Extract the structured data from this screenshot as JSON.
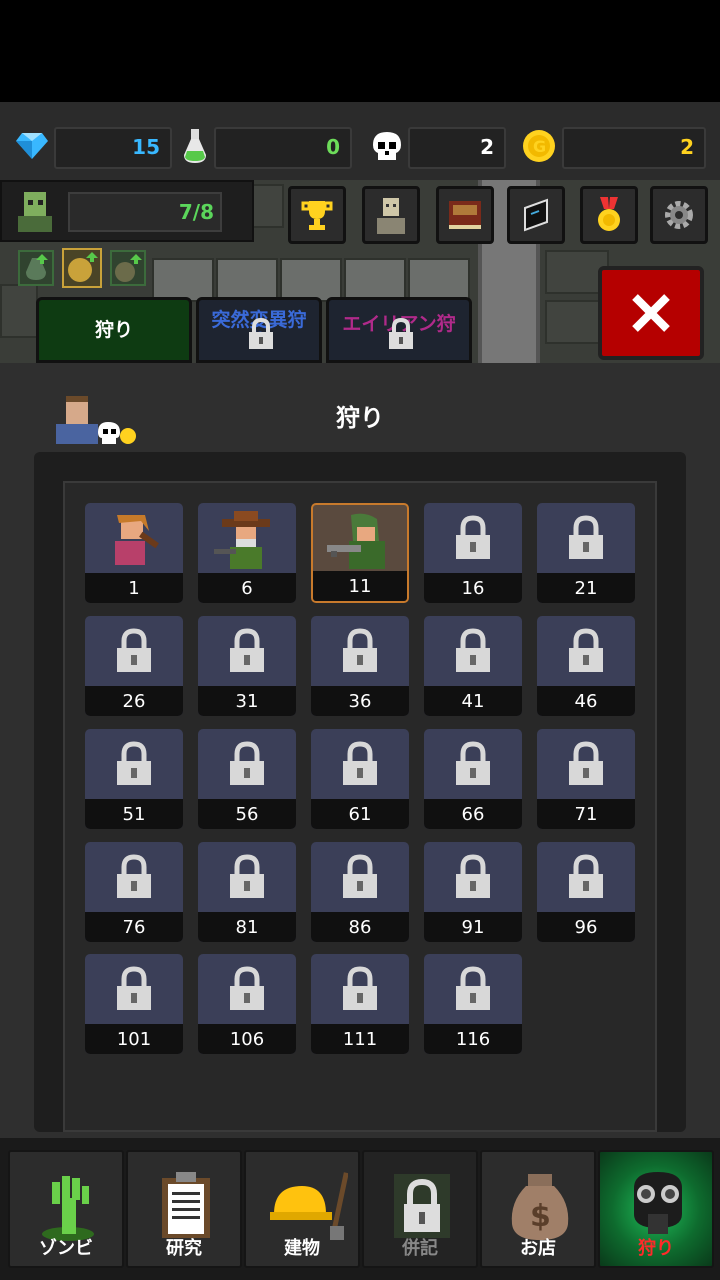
{
  "resources": [
    {
      "name": "gem-icon",
      "value": "15",
      "color": "#39b8ff"
    },
    {
      "name": "potion-icon",
      "value": "0",
      "color": "#6ddc5a"
    },
    {
      "name": "skull-icon",
      "value": "2",
      "color": "#ffffff"
    },
    {
      "name": "coin-icon",
      "value": "2",
      "color": "#ffd21f"
    }
  ],
  "zombie_count": "7/8",
  "header_buttons": [
    "trophy-icon",
    "zombie-bust-icon",
    "book-icon",
    "notebook-icon",
    "medal-icon",
    "gear-icon"
  ],
  "tabs": [
    {
      "label": "狩り",
      "locked": false
    },
    {
      "label": "突然変異狩り",
      "locked": true
    },
    {
      "label": "エイリアン狩",
      "locked": true
    }
  ],
  "page_title": "狩り",
  "levels": [
    {
      "level": "1",
      "state": "unlocked"
    },
    {
      "level": "6",
      "state": "unlocked"
    },
    {
      "level": "11",
      "state": "selected"
    },
    {
      "level": "16",
      "state": "locked"
    },
    {
      "level": "21",
      "state": "locked"
    },
    {
      "level": "26",
      "state": "locked"
    },
    {
      "level": "31",
      "state": "locked"
    },
    {
      "level": "36",
      "state": "locked"
    },
    {
      "level": "41",
      "state": "locked"
    },
    {
      "level": "46",
      "state": "locked"
    },
    {
      "level": "51",
      "state": "locked"
    },
    {
      "level": "56",
      "state": "locked"
    },
    {
      "level": "61",
      "state": "locked"
    },
    {
      "level": "66",
      "state": "locked"
    },
    {
      "level": "71",
      "state": "locked"
    },
    {
      "level": "76",
      "state": "locked"
    },
    {
      "level": "81",
      "state": "locked"
    },
    {
      "level": "86",
      "state": "locked"
    },
    {
      "level": "91",
      "state": "locked"
    },
    {
      "level": "96",
      "state": "locked"
    },
    {
      "level": "101",
      "state": "locked"
    },
    {
      "level": "106",
      "state": "locked"
    },
    {
      "level": "111",
      "state": "locked"
    },
    {
      "level": "116",
      "state": "locked"
    }
  ],
  "nav": [
    {
      "label": "ゾンビ",
      "icon": "zombie-hand-icon",
      "active": false
    },
    {
      "label": "研究",
      "icon": "clipboard-icon",
      "active": false
    },
    {
      "label": "建物",
      "icon": "hardhat-icon",
      "active": false
    },
    {
      "label": "併記",
      "icon": "lock-icon",
      "active": false,
      "locked": true
    },
    {
      "label": "お店",
      "icon": "money-bag-icon",
      "active": false
    },
    {
      "label": "狩り",
      "icon": "gasmask-icon",
      "active": true
    }
  ]
}
